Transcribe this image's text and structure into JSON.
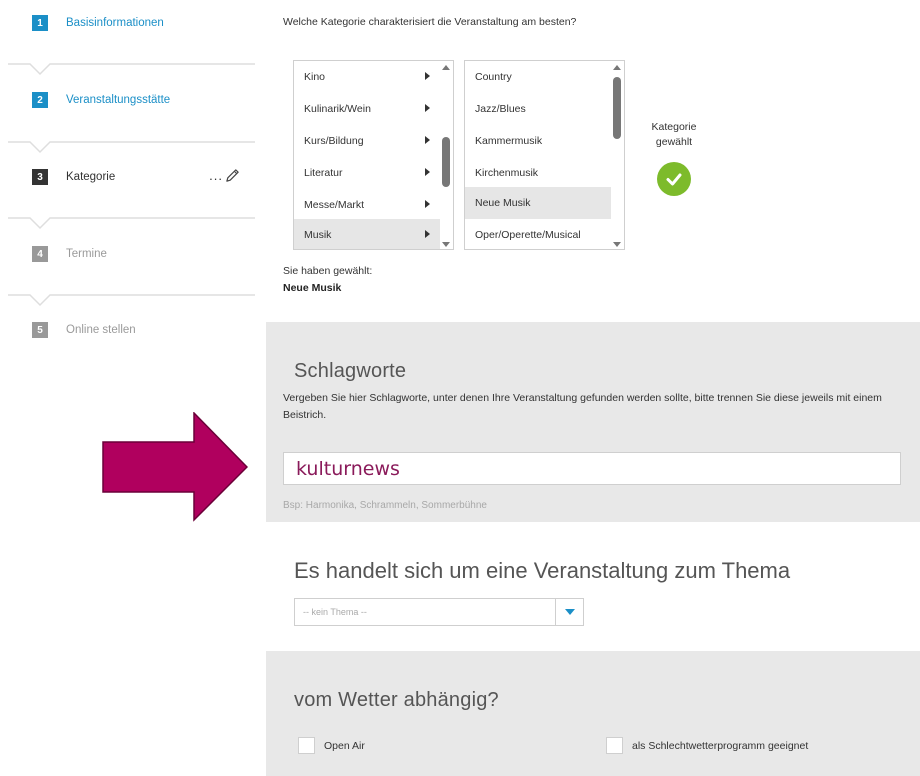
{
  "steps": [
    {
      "number": "1",
      "label": "Basisinformationen",
      "state": "done"
    },
    {
      "number": "2",
      "label": "Veranstaltungsstätte",
      "state": "done"
    },
    {
      "number": "3",
      "label": "Kategorie",
      "state": "current"
    },
    {
      "number": "4",
      "label": "Termine",
      "state": "pending"
    },
    {
      "number": "5",
      "label": "Online stellen",
      "state": "pending"
    }
  ],
  "step_edit": {
    "dots": "...",
    "icon": "pencil-icon"
  },
  "category": {
    "question": "Welche Kategorie charakterisiert die Veranstaltung am besten?",
    "main_list": [
      "Kino",
      "Kulinarik/Wein",
      "Kurs/Bildung",
      "Literatur",
      "Messe/Markt",
      "Musik"
    ],
    "main_selected": "Musik",
    "sub_list": [
      "Country",
      "Jazz/Blues",
      "Kammermusik",
      "Kirchenmusik",
      "Neue Musik",
      "Oper/Operette/Musical"
    ],
    "sub_selected": "Neue Musik",
    "status_line1": "Kategorie",
    "status_line2": "gewählt",
    "status_icon": "checkmark-icon",
    "chosen_label": "Sie haben gewählt:",
    "chosen_value": "Neue Musik"
  },
  "keywords": {
    "title": "Schlagworte",
    "description": "Vergeben Sie hier Schlagworte, unter denen Ihre Veranstaltung gefunden werden sollte, bitte trennen Sie diese jeweils mit einem Beistrich.",
    "value": "kulturnews",
    "hint": "Bsp: Harmonika, Schrammeln, Sommerbühne"
  },
  "thema": {
    "title": "Es handelt sich um eine Veranstaltung zum Thema",
    "selected": "-- kein Thema --"
  },
  "weather": {
    "title": "vom Wetter abhängig?",
    "option1": "Open Air",
    "option2": "als Schlechtwetterprogramm geeignet"
  },
  "colors": {
    "accent": "#1b8fc7",
    "success": "#7dbb2b",
    "arrow": "#b0005e",
    "keyword_text": "#8a1a5a"
  }
}
